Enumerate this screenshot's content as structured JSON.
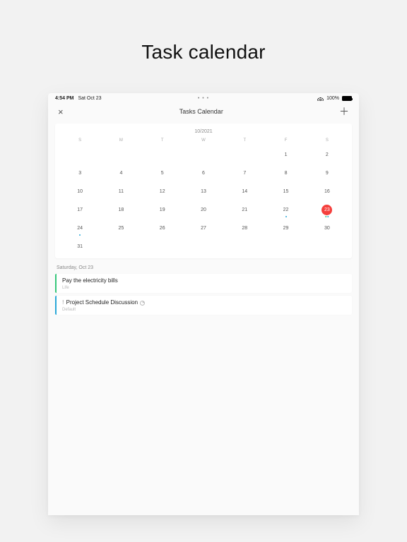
{
  "promo": {
    "title": "Task calendar"
  },
  "status": {
    "time": "4:54 PM",
    "date": "Sat Oct 23",
    "center_dots": "• • •",
    "battery_pct": "100%"
  },
  "header": {
    "title": "Tasks Calendar"
  },
  "calendar": {
    "month_label": "10/2021",
    "weekdays": [
      "S",
      "M",
      "T",
      "W",
      "T",
      "F",
      "S"
    ],
    "weeks": [
      [
        {
          "n": "",
          "muted": false
        },
        {
          "n": "",
          "muted": false
        },
        {
          "n": "",
          "muted": false
        },
        {
          "n": "",
          "muted": false
        },
        {
          "n": "",
          "muted": false
        },
        {
          "n": "1",
          "muted": false
        },
        {
          "n": "2",
          "muted": false
        }
      ],
      [
        {
          "n": "3"
        },
        {
          "n": "4"
        },
        {
          "n": "5"
        },
        {
          "n": "6"
        },
        {
          "n": "7"
        },
        {
          "n": "8"
        },
        {
          "n": "9"
        }
      ],
      [
        {
          "n": "10"
        },
        {
          "n": "11"
        },
        {
          "n": "12"
        },
        {
          "n": "13"
        },
        {
          "n": "14"
        },
        {
          "n": "15"
        },
        {
          "n": "16"
        }
      ],
      [
        {
          "n": "17"
        },
        {
          "n": "18"
        },
        {
          "n": "19"
        },
        {
          "n": "20"
        },
        {
          "n": "21"
        },
        {
          "n": "22",
          "dots": [
            "blue"
          ]
        },
        {
          "n": "23",
          "today": true,
          "dots": [
            "green",
            "blue"
          ]
        }
      ],
      [
        {
          "n": "24",
          "dots": [
            "blue"
          ]
        },
        {
          "n": "25"
        },
        {
          "n": "26"
        },
        {
          "n": "27"
        },
        {
          "n": "28"
        },
        {
          "n": "29"
        },
        {
          "n": "30"
        }
      ],
      [
        {
          "n": "31"
        },
        {
          "n": ""
        },
        {
          "n": ""
        },
        {
          "n": ""
        },
        {
          "n": ""
        },
        {
          "n": ""
        },
        {
          "n": ""
        }
      ]
    ]
  },
  "tasks": {
    "date_heading": "Saturday, Oct 23",
    "items": [
      {
        "title": "Pay the electricity bills",
        "tag": "Life",
        "color": "green",
        "priority": false,
        "has_time": false
      },
      {
        "title": "Project Schedule Discussion",
        "tag": "Default",
        "color": "blue",
        "priority": true,
        "has_time": true
      }
    ]
  },
  "colors": {
    "accent_red": "#f5403d",
    "green": "#36c77a",
    "blue": "#2aa8d8"
  }
}
